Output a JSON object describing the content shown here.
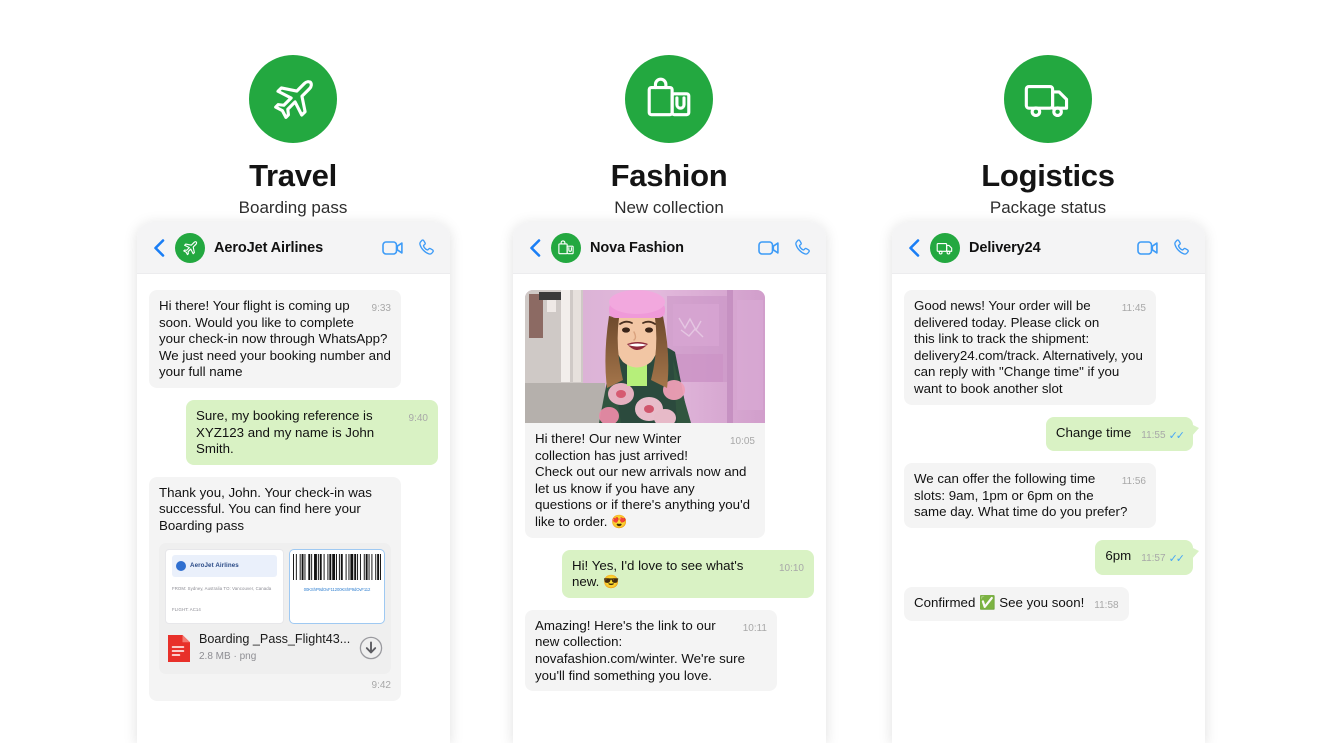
{
  "columns": [
    {
      "icon": "airplane-icon",
      "title": "Travel",
      "subtitle": "Boarding pass",
      "chat": {
        "back_icon": "back-chevron-icon",
        "avatar_icon": "airplane-icon",
        "contact_name": "AeroJet Airlines",
        "video_icon": "video-call-icon",
        "call_icon": "phone-call-icon",
        "messages": [
          {
            "type": "text",
            "side": "in",
            "text": "Hi there! Your flight is coming up soon. Would you like to complete your check-in now through WhatsApp? We just need your booking number and your full name",
            "time": "9:33",
            "ticks": ""
          },
          {
            "type": "text",
            "side": "out",
            "text": "Sure, my booking reference is XYZ123 and my name is John Smith.",
            "time": "9:40",
            "ticks": ""
          },
          {
            "type": "attachment",
            "side": "in",
            "text": "Thank you, John. Your check-in was successful. You can find here your Boarding pass",
            "time": "9:42",
            "ticks": "",
            "pass": {
              "brand": "AeroJet Airlines",
              "route": "FROM: Sydney, Australia     TO: Vancouver, Canada",
              "flight": "FLIGHT: AC14",
              "barcode_text": "00KShP9dOvF11200KShP9dOvF112"
            },
            "file": {
              "name": "Boarding _Pass_Flight43...",
              "size": "2.8 MB · png",
              "doc_icon": "document-icon",
              "download_icon": "download-icon"
            }
          }
        ]
      }
    },
    {
      "icon": "shopping-bag-icon",
      "title": "Fashion",
      "subtitle": "New collection",
      "chat": {
        "back_icon": "back-chevron-icon",
        "avatar_icon": "shopping-bag-icon",
        "contact_name": "Nova Fashion",
        "video_icon": "video-call-icon",
        "call_icon": "phone-call-icon",
        "messages": [
          {
            "type": "photo",
            "side": "in",
            "photo_alt": "woman-in-pink-beanie-photo",
            "text": "Hi there! Our new Winter collection has just arrived! Check out our new arrivals now and let us know if you have any questions or if there's anything you'd like to order. ",
            "emoji": "😍",
            "time": "10:05",
            "ticks": ""
          },
          {
            "type": "text",
            "side": "out",
            "text": "Hi! Yes, I'd love to see what's new. ",
            "emoji": "😎",
            "time": "10:10",
            "ticks": ""
          },
          {
            "type": "text",
            "side": "in",
            "text": "Amazing! Here's the link to our new collection: novafashion.com/winter. We're sure you'll find something you love.",
            "time": "10:11",
            "ticks": ""
          }
        ]
      }
    },
    {
      "icon": "delivery-truck-icon",
      "title": "Logistics",
      "subtitle": "Package status",
      "chat": {
        "back_icon": "back-chevron-icon",
        "avatar_icon": "delivery-truck-icon",
        "contact_name": "Delivery24",
        "video_icon": "video-call-icon",
        "call_icon": "phone-call-icon",
        "messages": [
          {
            "type": "text",
            "side": "in",
            "text": "Good news! Your order will be delivered today. Please click on this link to track the shipment: delivery24.com/track. Alternatively, you can reply with \"Change time\" if you want to book another slot",
            "time": "11:45",
            "ticks": ""
          },
          {
            "type": "text",
            "side": "out",
            "tail": true,
            "inline": true,
            "text": "Change time",
            "time": "11:55",
            "ticks": "✓✓"
          },
          {
            "type": "text",
            "side": "in",
            "text": "We can offer the following time slots: 9am, 1pm or 6pm on the same day. What time do you prefer?",
            "time": "11:56",
            "ticks": ""
          },
          {
            "type": "text",
            "side": "out",
            "tail": true,
            "inline": true,
            "text": "6pm",
            "time": "11:57",
            "ticks": "✓✓"
          },
          {
            "type": "text",
            "side": "in",
            "inline": true,
            "text": "Confirmed ✅ See you soon!",
            "time": "11:58",
            "ticks": ""
          }
        ]
      }
    }
  ],
  "colors": {
    "brand_green": "#23a840",
    "outgoing_bubble": "#d9f2c4",
    "incoming_bubble": "#f4f4f4",
    "accent_blue": "#1a7ef5",
    "tick_blue": "#49a7f5",
    "doc_red": "#e8302a"
  }
}
